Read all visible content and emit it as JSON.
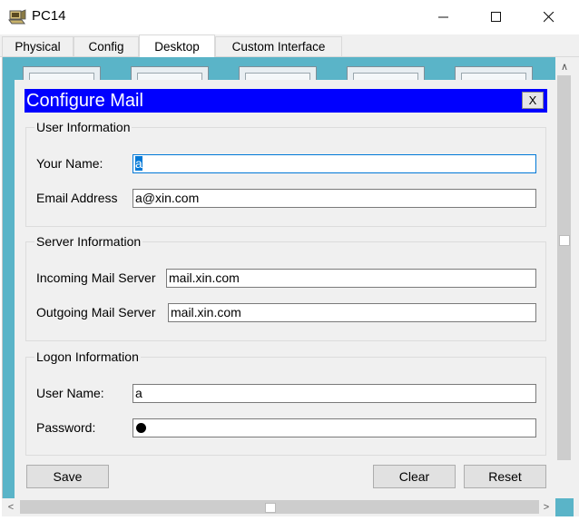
{
  "window": {
    "title": "PC14"
  },
  "tabs": [
    {
      "label": "Physical",
      "active": false
    },
    {
      "label": "Config",
      "active": false
    },
    {
      "label": "Desktop",
      "active": true
    },
    {
      "label": "Custom Interface",
      "active": false
    }
  ],
  "dialog": {
    "title": "Configure Mail",
    "close_label": "X",
    "user_info": {
      "title": "User Information",
      "name_label": "Your Name:",
      "name_value_selected": "a",
      "email_label": "Email Address",
      "email_value": "a@xin.com"
    },
    "server_info": {
      "title": "Server Information",
      "incoming_label": "Incoming Mail Server",
      "incoming_value": "mail.xin.com",
      "outgoing_label": "Outgoing Mail Server",
      "outgoing_value": "mail.xin.com"
    },
    "logon_info": {
      "title": "Logon Information",
      "username_label": "User Name:",
      "username_value": "a",
      "password_label": "Password:",
      "password_length": 1
    },
    "buttons": {
      "save": "Save",
      "clear": "Clear",
      "reset": "Reset"
    }
  },
  "colors": {
    "dialog_header": "#0000ff",
    "desktop_bg": "#5ab4c8",
    "selection": "#0078d7"
  }
}
